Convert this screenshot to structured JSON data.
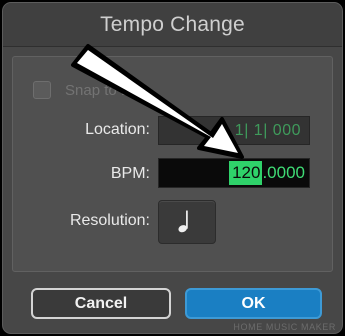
{
  "dialog": {
    "title": "Tempo Change"
  },
  "snap_to_bar": {
    "label": "Snap to Bar",
    "checked": false,
    "enabled": false
  },
  "location": {
    "label": "Location:",
    "value": "1| 1| 000"
  },
  "bpm": {
    "label": "BPM:",
    "selected_part": "120",
    "rest_part": ".0000"
  },
  "resolution": {
    "label": "Resolution:",
    "icon": "quarter-note-icon"
  },
  "buttons": {
    "cancel_label": "Cancel",
    "ok_label": "OK"
  },
  "watermark": {
    "text": "HOME MUSIC MAKER"
  },
  "annotation": {
    "icon": "arrow-icon"
  },
  "colors": {
    "value_green": "#3f9a5b",
    "selection_green": "#2fd26a",
    "ok_blue": "#1a7fc3"
  }
}
